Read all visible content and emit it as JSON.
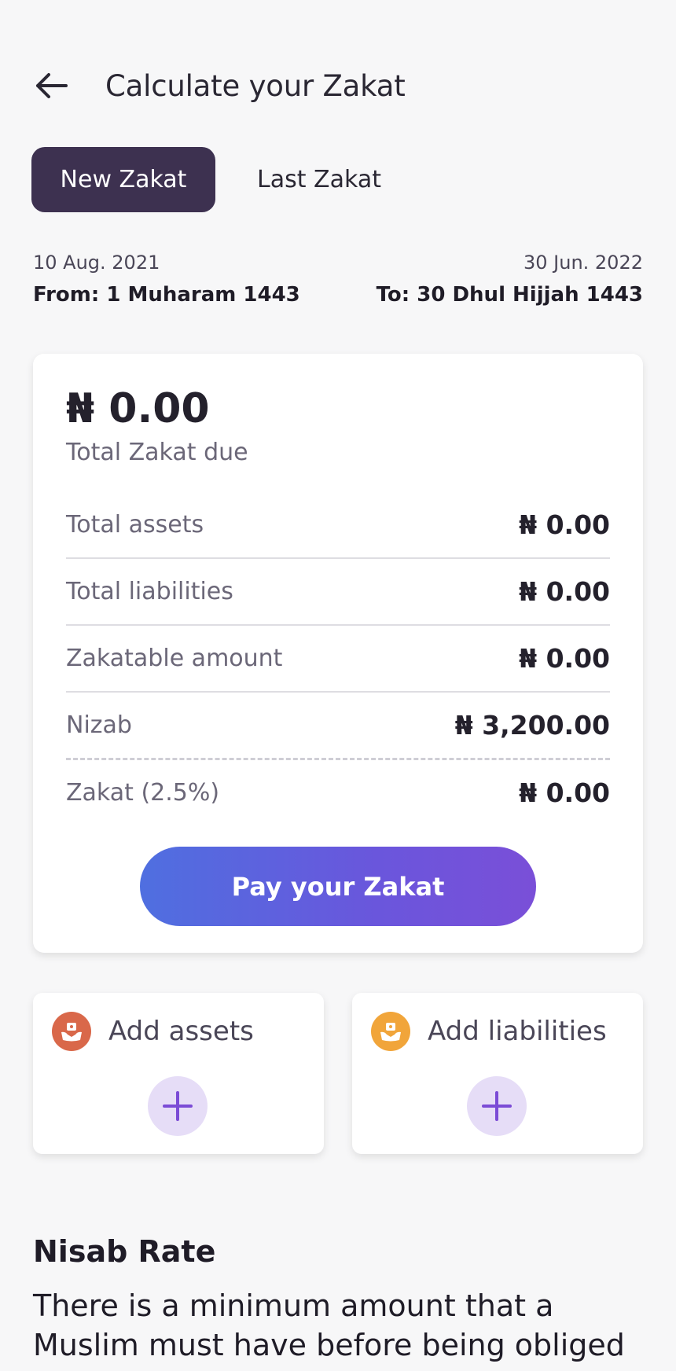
{
  "header": {
    "title": "Calculate your Zakat",
    "back_icon": "arrow-left-icon"
  },
  "tabs": [
    {
      "label": "New Zakat",
      "active": true
    },
    {
      "label": "Last Zakat",
      "active": false
    }
  ],
  "period": {
    "from_date": "10 Aug. 2021",
    "from_hijri": "From: 1 Muharam 1443",
    "to_date": "30 Jun. 2022",
    "to_hijri": "To: 30 Dhul Hijjah 1443"
  },
  "summary": {
    "total_due": "₦ 0.00",
    "total_due_label": "Total Zakat due",
    "rows": [
      {
        "label": "Total assets",
        "value": "₦ 0.00"
      },
      {
        "label": "Total liabilities",
        "value": "₦ 0.00"
      },
      {
        "label": "Zakatable amount",
        "value": "₦ 0.00"
      },
      {
        "label": "Nizab",
        "value": "₦ 3,200.00"
      },
      {
        "label": "Zakat (2.5%)",
        "value": "₦ 0.00"
      }
    ],
    "pay_button": "Pay your Zakat"
  },
  "actions": {
    "assets": {
      "label": "Add assets",
      "icon": "hand-money-icon",
      "color": "#d9684a"
    },
    "liabilities": {
      "label": "Add liabilities",
      "icon": "hand-money-icon",
      "color": "#f1a53a"
    }
  },
  "nisab": {
    "title": "Nisab Rate",
    "text": "There is a minimum amount that a Muslim must have before being obliged"
  },
  "colors": {
    "tab_active_bg": "#3d3150",
    "button_gradient_start": "#4f6fe0",
    "button_gradient_end": "#7a4fd8",
    "plus_bg": "#e6ddf7",
    "plus_fg": "#7b4bd6"
  }
}
